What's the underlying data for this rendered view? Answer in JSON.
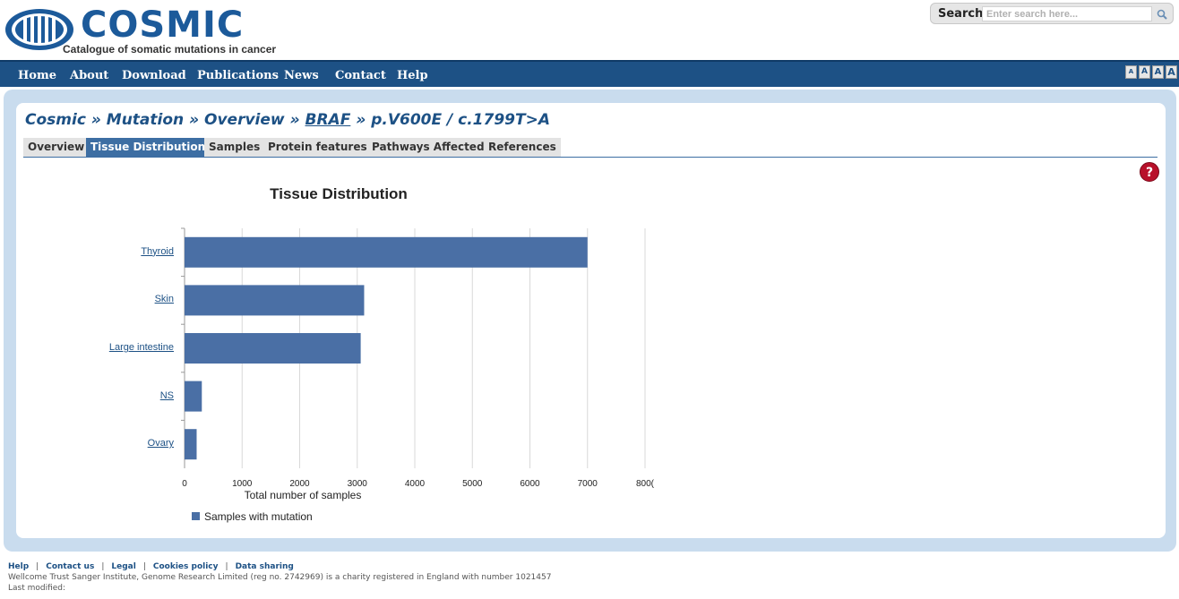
{
  "header": {
    "logo_word": "COSMIC",
    "logo_subtitle": "Catalogue of somatic mutations in cancer",
    "search_label": "Search",
    "search_placeholder": "Enter search here..."
  },
  "nav": {
    "items": [
      "Home",
      "About",
      "Download",
      "Publications",
      "News",
      "Contact",
      "Help"
    ],
    "text_size": [
      "A",
      "A",
      "A",
      "A"
    ]
  },
  "breadcrumb": {
    "part1": "Cosmic » Mutation » Overview » ",
    "gene": "BRAF",
    "part2": " » p.V600E / c.1799T>A"
  },
  "tabs": [
    "Overview",
    "Tissue Distribution",
    "Samples",
    "Protein features",
    "Pathways Affected",
    "References"
  ],
  "active_tab": "Tissue Distribution",
  "help_label": "?",
  "chart_data": {
    "type": "bar",
    "orientation": "horizontal",
    "title": "Tissue Distribution",
    "categories": [
      "Thyroid",
      "Skin",
      "Large intestine",
      "NS",
      "Ovary"
    ],
    "series": [
      {
        "name": "Samples with mutation",
        "values": [
          7000,
          3120,
          3060,
          300,
          210
        ],
        "color": "#4a6fa5"
      }
    ],
    "xlabel": "Total number of samples",
    "xlim": [
      0,
      8000
    ],
    "xticks": [
      "0",
      "1000",
      "2000",
      "3000",
      "4000",
      "5000",
      "6000",
      "7000",
      "800("
    ],
    "grid": true,
    "legend": "bottom-left"
  },
  "footer": {
    "links": [
      "Help",
      "Contact us",
      "Legal",
      "Cookies policy",
      "Data sharing"
    ],
    "charity": "Wellcome Trust Sanger Institute, Genome Research Limited (reg no. 2742969) is a charity registered in England with number 1021457",
    "last_modified": "Last modified:"
  }
}
